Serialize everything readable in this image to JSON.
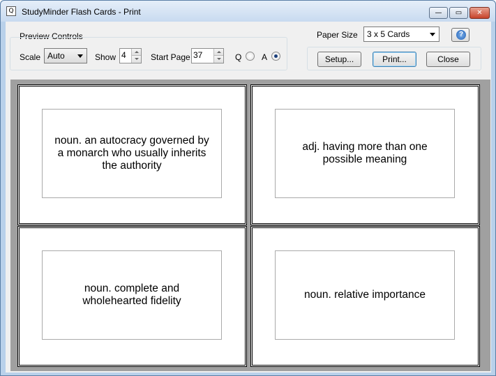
{
  "window": {
    "title": "StudyMinder Flash Cards - Print",
    "app_icon": "Q",
    "minimize_glyph": "—",
    "maximize_glyph": "▭",
    "close_glyph": "✕"
  },
  "preview_controls": {
    "group_label": "Preview Controls",
    "scale_label": "Scale",
    "scale_value": "Auto",
    "show_label": "Show",
    "show_value": "4",
    "start_page_label": "Start Page",
    "start_page_value": "37",
    "q_label": "Q",
    "a_label": "A",
    "selected_side": "A"
  },
  "paper": {
    "label": "Paper Size",
    "value": "3 x 5 Cards"
  },
  "help_glyph": "?",
  "buttons": {
    "setup": "Setup...",
    "print": "Print...",
    "close": "Close"
  },
  "cards": [
    {
      "text": "noun. an autocracy governed by a monarch who usually inherits the authority"
    },
    {
      "text": "adj. having more than one possible meaning"
    },
    {
      "text": "noun. complete and wholehearted fidelity"
    },
    {
      "text": "noun. relative importance"
    }
  ],
  "colors": {
    "preview_bg": "#a0a0a0",
    "window_frame": "#b9d1ea",
    "close_button": "#c7432b"
  },
  "icons": [
    "app-icon",
    "minimize-icon",
    "maximize-icon",
    "close-icon",
    "help-icon",
    "chevron-down-icon"
  ]
}
